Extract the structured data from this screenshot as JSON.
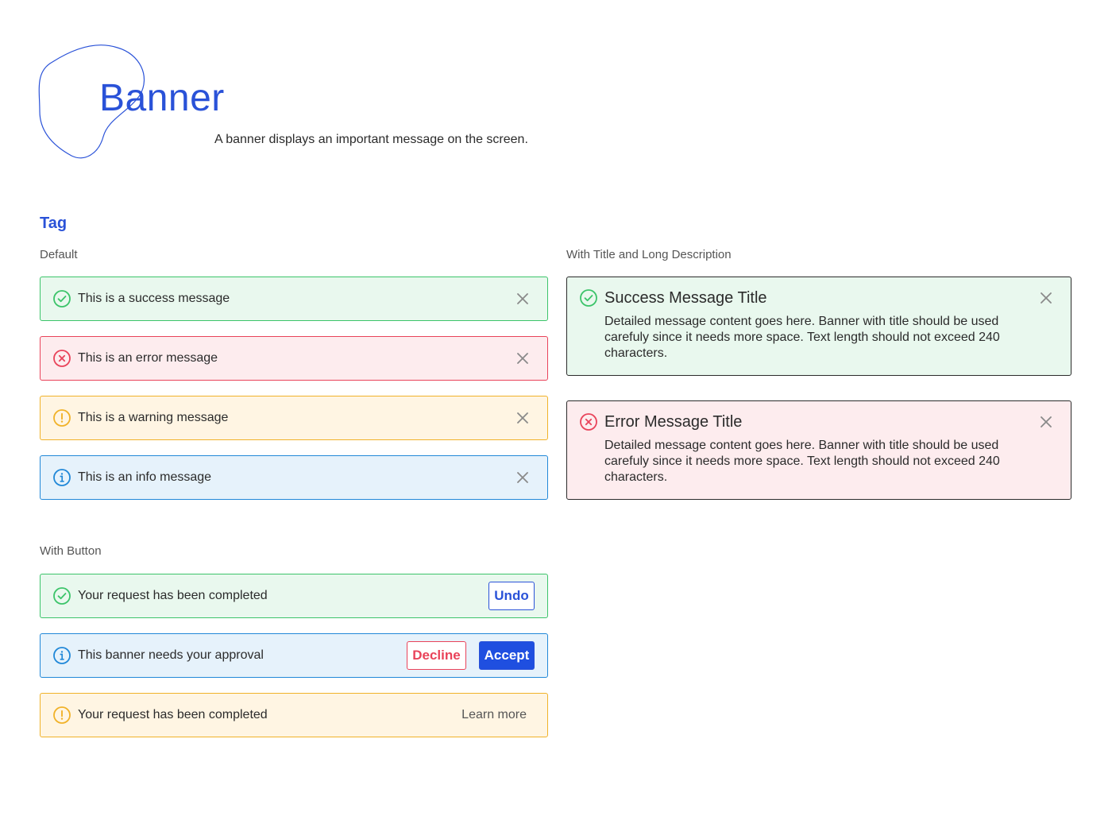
{
  "header": {
    "title": "Banner",
    "description": "A banner displays an important message on the screen."
  },
  "section": {
    "title": "Tag"
  },
  "groups": {
    "default_label": "Default",
    "with_title_label": "With Title and Long Description",
    "with_button_label": "With Button"
  },
  "default_banners": [
    {
      "type": "success",
      "message": "This is a success message",
      "icon": "check-circle-icon"
    },
    {
      "type": "error",
      "message": "This is an error message",
      "icon": "x-circle-icon"
    },
    {
      "type": "warning",
      "message": "This is a warning message",
      "icon": "exclamation-circle-icon"
    },
    {
      "type": "info",
      "message": "This is an info message",
      "icon": "info-circle-icon"
    }
  ],
  "titled_banners": [
    {
      "type": "success",
      "title": "Success Message Title",
      "description": "Detailed message content goes here. Banner with title should be used carefuly since it needs more space. Text length should not exceed 240 characters."
    },
    {
      "type": "error",
      "title": "Error Message Title",
      "description": "Detailed message content goes here. Banner with title should be used carefuly since it needs more space. Text length should not exceed 240 characters."
    }
  ],
  "button_banners": [
    {
      "type": "success",
      "message": "Your request has been completed",
      "buttons": [
        "Undo"
      ]
    },
    {
      "type": "info",
      "message": "This banner needs your approval",
      "buttons": [
        "Decline",
        "Accept"
      ]
    },
    {
      "type": "warning",
      "message": "Your request has been completed",
      "buttons": [
        "Learn more"
      ]
    }
  ],
  "colors": {
    "accent": "#2a52d8",
    "success": "#3cc46a",
    "error": "#e9435a",
    "warning": "#f1b229",
    "info": "#2188d8"
  }
}
